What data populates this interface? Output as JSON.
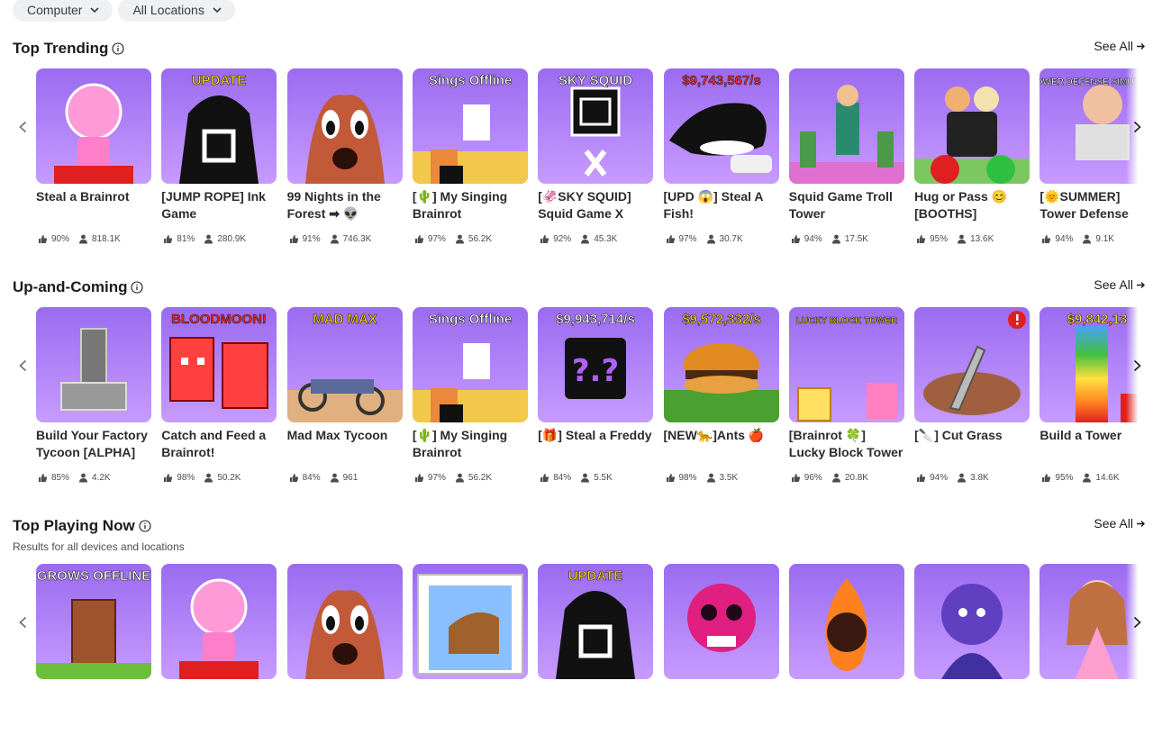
{
  "filters": {
    "device": "Computer",
    "location": "All Locations"
  },
  "see_all_label": "See All",
  "sections": [
    {
      "title": "Top Trending",
      "cards": [
        {
          "title": "Steal a Brainrot",
          "rating": "90%",
          "players": "818.1K",
          "thumb_text": ""
        },
        {
          "title": "[JUMP ROPE] Ink Game",
          "rating": "81%",
          "players": "280.9K",
          "thumb_text": "UPDATE"
        },
        {
          "title": "99 Nights in the Forest ➡ 👽",
          "rating": "91%",
          "players": "746.3K",
          "thumb_text": ""
        },
        {
          "title": "[🌵] My Singing Brainrot",
          "rating": "97%",
          "players": "56.2K",
          "thumb_text": "Sings Offline"
        },
        {
          "title": "[🦑SKY SQUID] Squid Game X",
          "rating": "92%",
          "players": "45.3K",
          "thumb_text": "SKY SQUID"
        },
        {
          "title": "[UPD 😱] Steal A Fish!",
          "rating": "97%",
          "players": "30.7K",
          "thumb_text": "$9,743,567/s"
        },
        {
          "title": "Squid Game Troll Tower",
          "rating": "94%",
          "players": "17.5K",
          "thumb_text": ""
        },
        {
          "title": "Hug or Pass 😊 [BOOTHS]",
          "rating": "95%",
          "players": "13.6K",
          "thumb_text": ""
        },
        {
          "title": "[🌞SUMMER] Tower Defense",
          "rating": "94%",
          "players": "9.1K",
          "thumb_text": "TOWER DEFENSE SIMULATOR"
        }
      ]
    },
    {
      "title": "Up-and-Coming",
      "cards": [
        {
          "title": "Build Your Factory Tycoon [ALPHA]",
          "rating": "85%",
          "players": "4.2K",
          "thumb_text": ""
        },
        {
          "title": "Catch and Feed a Brainrot!",
          "rating": "98%",
          "players": "50.2K",
          "thumb_text": "BLOODMOON!"
        },
        {
          "title": "Mad Max Tycoon",
          "rating": "84%",
          "players": "961",
          "thumb_text": "MAD MAX"
        },
        {
          "title": "[🌵] My Singing Brainrot",
          "rating": "97%",
          "players": "56.2K",
          "thumb_text": "Sings Offline"
        },
        {
          "title": "[🎁] Steal a Freddy",
          "rating": "84%",
          "players": "5.5K",
          "thumb_text": "$9,943,714/s"
        },
        {
          "title": "[NEW🐆]Ants 🍎",
          "rating": "98%",
          "players": "3.5K",
          "thumb_text": "$9,572,332/s"
        },
        {
          "title": "[Brainrot 🍀] Lucky Block Tower",
          "rating": "96%",
          "players": "20.8K",
          "thumb_text": "LUCKY BLOCK TOWER"
        },
        {
          "title": "[🔪] Cut Grass",
          "rating": "94%",
          "players": "3.8K",
          "thumb_text": ""
        },
        {
          "title": "Build a Tower",
          "rating": "95%",
          "players": "14.6K",
          "thumb_text": "$9,842,13"
        }
      ]
    },
    {
      "title": "Top Playing Now",
      "subtitle": "Results for all devices and locations",
      "cards": [
        {
          "title": "",
          "thumb_text": "GROWS OFFLINE"
        },
        {
          "title": "",
          "thumb_text": ""
        },
        {
          "title": "",
          "thumb_text": ""
        },
        {
          "title": "",
          "thumb_text": ""
        },
        {
          "title": "",
          "thumb_text": "UPDATE"
        },
        {
          "title": "",
          "thumb_text": ""
        },
        {
          "title": "",
          "thumb_text": ""
        },
        {
          "title": "",
          "thumb_text": ""
        },
        {
          "title": "",
          "thumb_text": ""
        }
      ]
    }
  ],
  "colors": {
    "accent": "#1b1c1f",
    "chip_bg": "#eef0f2",
    "muted": "#4b4d52"
  }
}
